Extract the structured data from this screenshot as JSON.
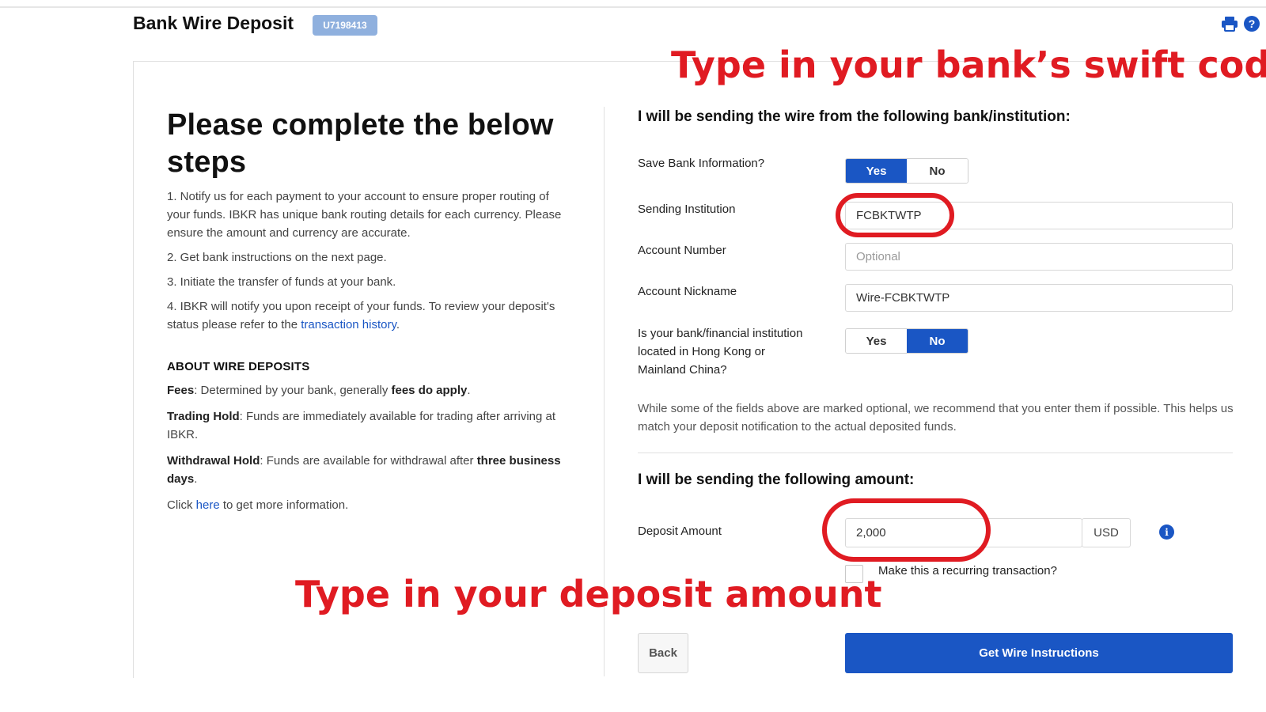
{
  "header": {
    "title": "Bank Wire Deposit",
    "account_id": "U7198413"
  },
  "instructions": {
    "heading": "Please complete the below steps",
    "steps": [
      "1. Notify us for each payment to your account to ensure proper routing of your funds. IBKR has unique bank routing details for each currency. Please ensure the amount and currency are accurate.",
      "2. Get bank instructions on the next page.",
      "3. Initiate the transfer of funds at your bank.",
      "4. IBKR will notify you upon receipt of your funds. To review your deposit's status please refer to the "
    ],
    "step4_link": "transaction history",
    "step4_tail": "."
  },
  "about": {
    "heading": "ABOUT WIRE DEPOSITS",
    "fees_label": "Fees",
    "fees_text": ": Determined by your bank, generally ",
    "fees_bold": "fees do apply",
    "fees_tail": ".",
    "trading_label": "Trading Hold",
    "trading_text": ": Funds are immediately available for trading after arriving at IBKR.",
    "withdrawal_label": "Withdrawal Hold",
    "withdrawal_text": ": Funds are available for withdrawal after ",
    "withdrawal_bold": "three business days",
    "withdrawal_tail": ".",
    "more_prefix": "Click ",
    "more_link": "here",
    "more_suffix": " to get more information."
  },
  "bank_section": {
    "heading": "I will be sending the wire from the following bank/institution:",
    "save_bank_label": "Save Bank Information?",
    "save_bank_options": [
      "Yes",
      "No"
    ],
    "save_bank_selected": "Yes",
    "sending_institution_label": "Sending Institution",
    "sending_institution_value": "FCBKTWTP",
    "account_number_label": "Account Number",
    "account_number_placeholder": "Optional",
    "account_nickname_label": "Account Nickname",
    "account_nickname_value": "Wire-FCBKTWTP",
    "hk_china_label": "Is your bank/financial institution located in Hong Kong or Mainland China?",
    "hk_china_options": [
      "Yes",
      "No"
    ],
    "hk_china_selected": "No",
    "note": "While some of the fields above are marked optional, we recommend that you enter them if possible. This helps us match your deposit notification to the actual deposited funds."
  },
  "amount_section": {
    "heading": "I will be sending the following amount:",
    "deposit_amount_label": "Deposit Amount",
    "deposit_amount_value": "2,000",
    "currency": "USD",
    "recurring_label": "Make this a recurring transaction?",
    "recurring_checked": false
  },
  "actions": {
    "back_label": "Back",
    "submit_label": "Get Wire Instructions"
  },
  "annotations": {
    "swift_code": "Type in your bank’s swift code",
    "deposit_amount": "Type in your deposit amount"
  },
  "icons": {
    "print": "printer-icon",
    "help": "help-icon",
    "info": "info-icon"
  },
  "colors": {
    "accent": "#1a56c4",
    "badge": "#8fb0de",
    "annotation": "#e01b22"
  }
}
